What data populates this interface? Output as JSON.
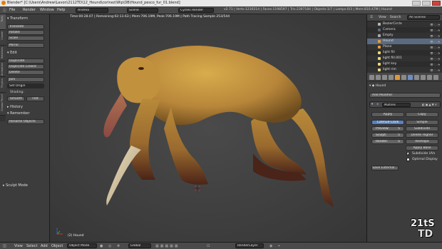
{
  "window": {
    "title": "Blender* [C:\\Users\\Andrew\\Lavon\\2112TD\\12_Hound\\corinez\\Wip\\DB\\Hound_pesco_fur_01.blend]"
  },
  "infobar": {
    "menus": [
      "File",
      "Render",
      "Window",
      "Help"
    ],
    "screen_layout": "Andrea",
    "scene": "Scene",
    "render_engine": "Cycles Render",
    "stats": "v2.71 | Verts:1230214 | Faces:1198597 | Tris:2397184 | Objects:1/7 | Lamps:0/3 | Mem:810.47M | Hound"
  },
  "toolshelf": {
    "vertical_tabs": [
      "Tools",
      "Create",
      "Relations",
      "Animation",
      "Physics",
      "Grease Pencil"
    ],
    "transform_header": "Transform",
    "transform_buttons": [
      "Translate",
      "Rotate",
      "Scale",
      "Mirror"
    ],
    "edit_header": "Edit",
    "edit_buttons": [
      "Duplicate",
      "Duplicate Linked",
      "Delete",
      "Join"
    ],
    "set_origin": "Set Origin",
    "shading_label": "Shading:",
    "shading_smooth": "Smooth",
    "shading_flat": "Flat",
    "history_header": "History",
    "remember_header": "Remember",
    "rename_button": "Rename Objects",
    "sculpt_mode_header": "Sculpt Mode"
  },
  "viewport": {
    "info_line1": "Time:00:28.07 | Remaining:02:13.63 | Mem:706.19M, Peak:706.19M | Path Tracing Sample 253/544",
    "object_name": "(2) Hound",
    "colors": {
      "creature_body": "#c89a3c",
      "creature_shadow": "#6b4a1d",
      "trunk": "#a05a52",
      "tusk": "#d9c9a0",
      "leg_dark": "#4a2418"
    }
  },
  "outliner": {
    "view_menu": "View",
    "search_menu": "Search",
    "scene_dropdown": "All Scenes",
    "rows": [
      "BezierCircle",
      "Camera",
      "Empty",
      "Hound",
      "Plane",
      "light fill",
      "light fill.001",
      "light key",
      "light rim"
    ]
  },
  "properties": {
    "object_name": "Hound",
    "add_modifier": "Add Modifier",
    "modifier_name": "Multires",
    "apply_label": "Apply",
    "copy_label": "Copy",
    "catmull_clark": "Catmull-Clark",
    "simple": "Simple",
    "preview_label": "Preview:",
    "preview_value": "5",
    "sculpt_label": "Sculpt:",
    "sculpt_value": "5",
    "render_label": "Render:",
    "render_value": "5",
    "subdivide": "Subdivide",
    "delete_higher": "Delete Higher",
    "reshape": "Reshape",
    "apply_base": "Apply Base",
    "subdivide_uvs": "Subdivide UVs",
    "optimal_display": "Optimal Display",
    "save_external": "Save External..."
  },
  "bottombar": {
    "menus": [
      "View",
      "Select",
      "Add",
      "Object"
    ],
    "mode": "Object Mode",
    "orientation": "Global",
    "render_layer": "RenderLayer"
  },
  "watermark": {
    "line1": "21tS",
    "line2": "TD"
  }
}
